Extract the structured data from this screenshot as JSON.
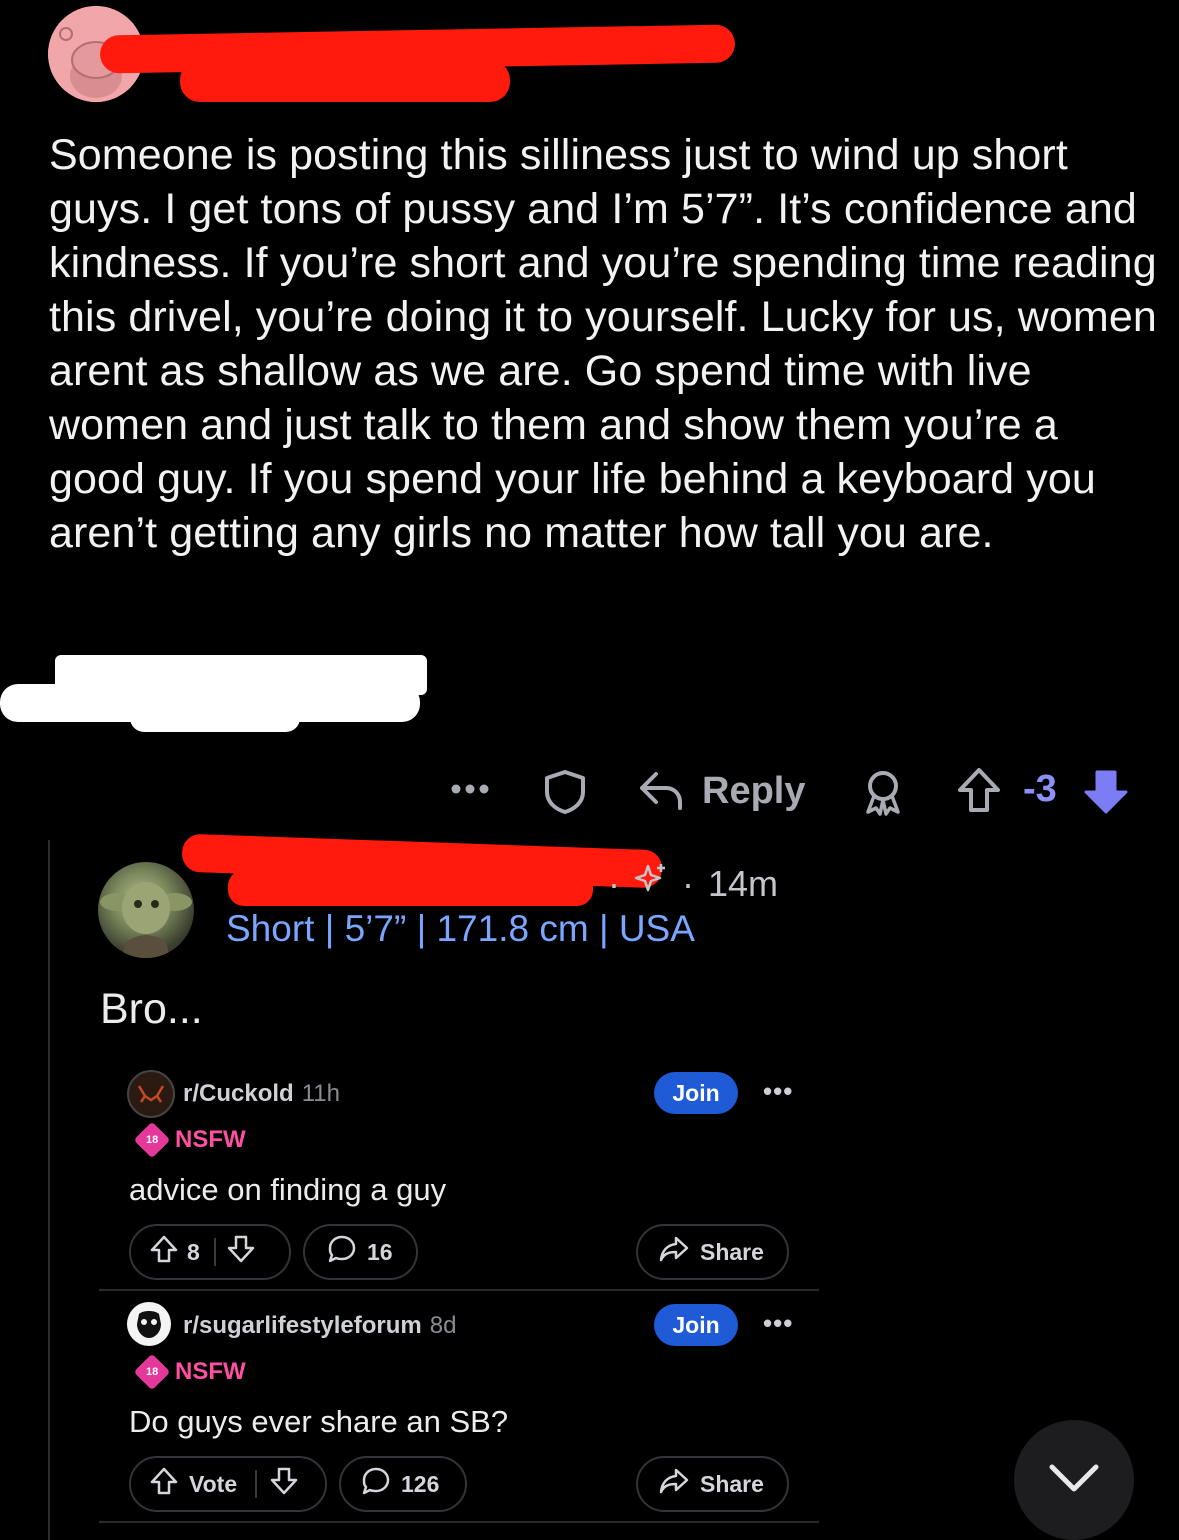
{
  "comment": {
    "text": "Someone is posting this silliness just to wind up short guys. I get tons of pussy and I’m 5’7”. It’s confidence and kindness. If you’re short and you’re spending time reading this drivel, you’re doing it to yourself. Lucky for us, women arent as shallow as we are. Go spend time with live women and just talk to them and show them you’re a good guy. If you spend your life behind a keyboard you aren’t getting any girls no matter how tall you are.",
    "actions": {
      "more_icon": "more-horizontal-icon",
      "award_icon": "shield-icon",
      "reply_label": "Reply",
      "reply_icon": "reply-arrow-icon",
      "achievement_icon": "award-icon",
      "score": "-3"
    }
  },
  "reply": {
    "separator": "·",
    "time": "14m",
    "flair": "Short | 5’7” | 171.8 cm | USA",
    "text": "Bro..."
  },
  "embedded_posts": [
    {
      "subreddit": "r/Cuckold",
      "time": "11h",
      "nsfw_label": "NSFW",
      "nsfw_badge": "18",
      "join_label": "Join",
      "title": "advice on finding a guy",
      "votes": "8",
      "comments": "16",
      "share_label": "Share"
    },
    {
      "subreddit": "r/sugarlifestyleforum",
      "time": "8d",
      "nsfw_label": "NSFW",
      "nsfw_badge": "18",
      "join_label": "Join",
      "title": "Do guys ever share an SB?",
      "votes": "Vote",
      "comments": "126",
      "share_label": "Share"
    }
  ],
  "colors": {
    "background": "#000000",
    "flair": "#7aa6ff",
    "downvote_active": "#7c7cf5",
    "join": "#1f5bd6",
    "nsfw": "#ff4fa3",
    "redaction": "#ff1a0d"
  }
}
